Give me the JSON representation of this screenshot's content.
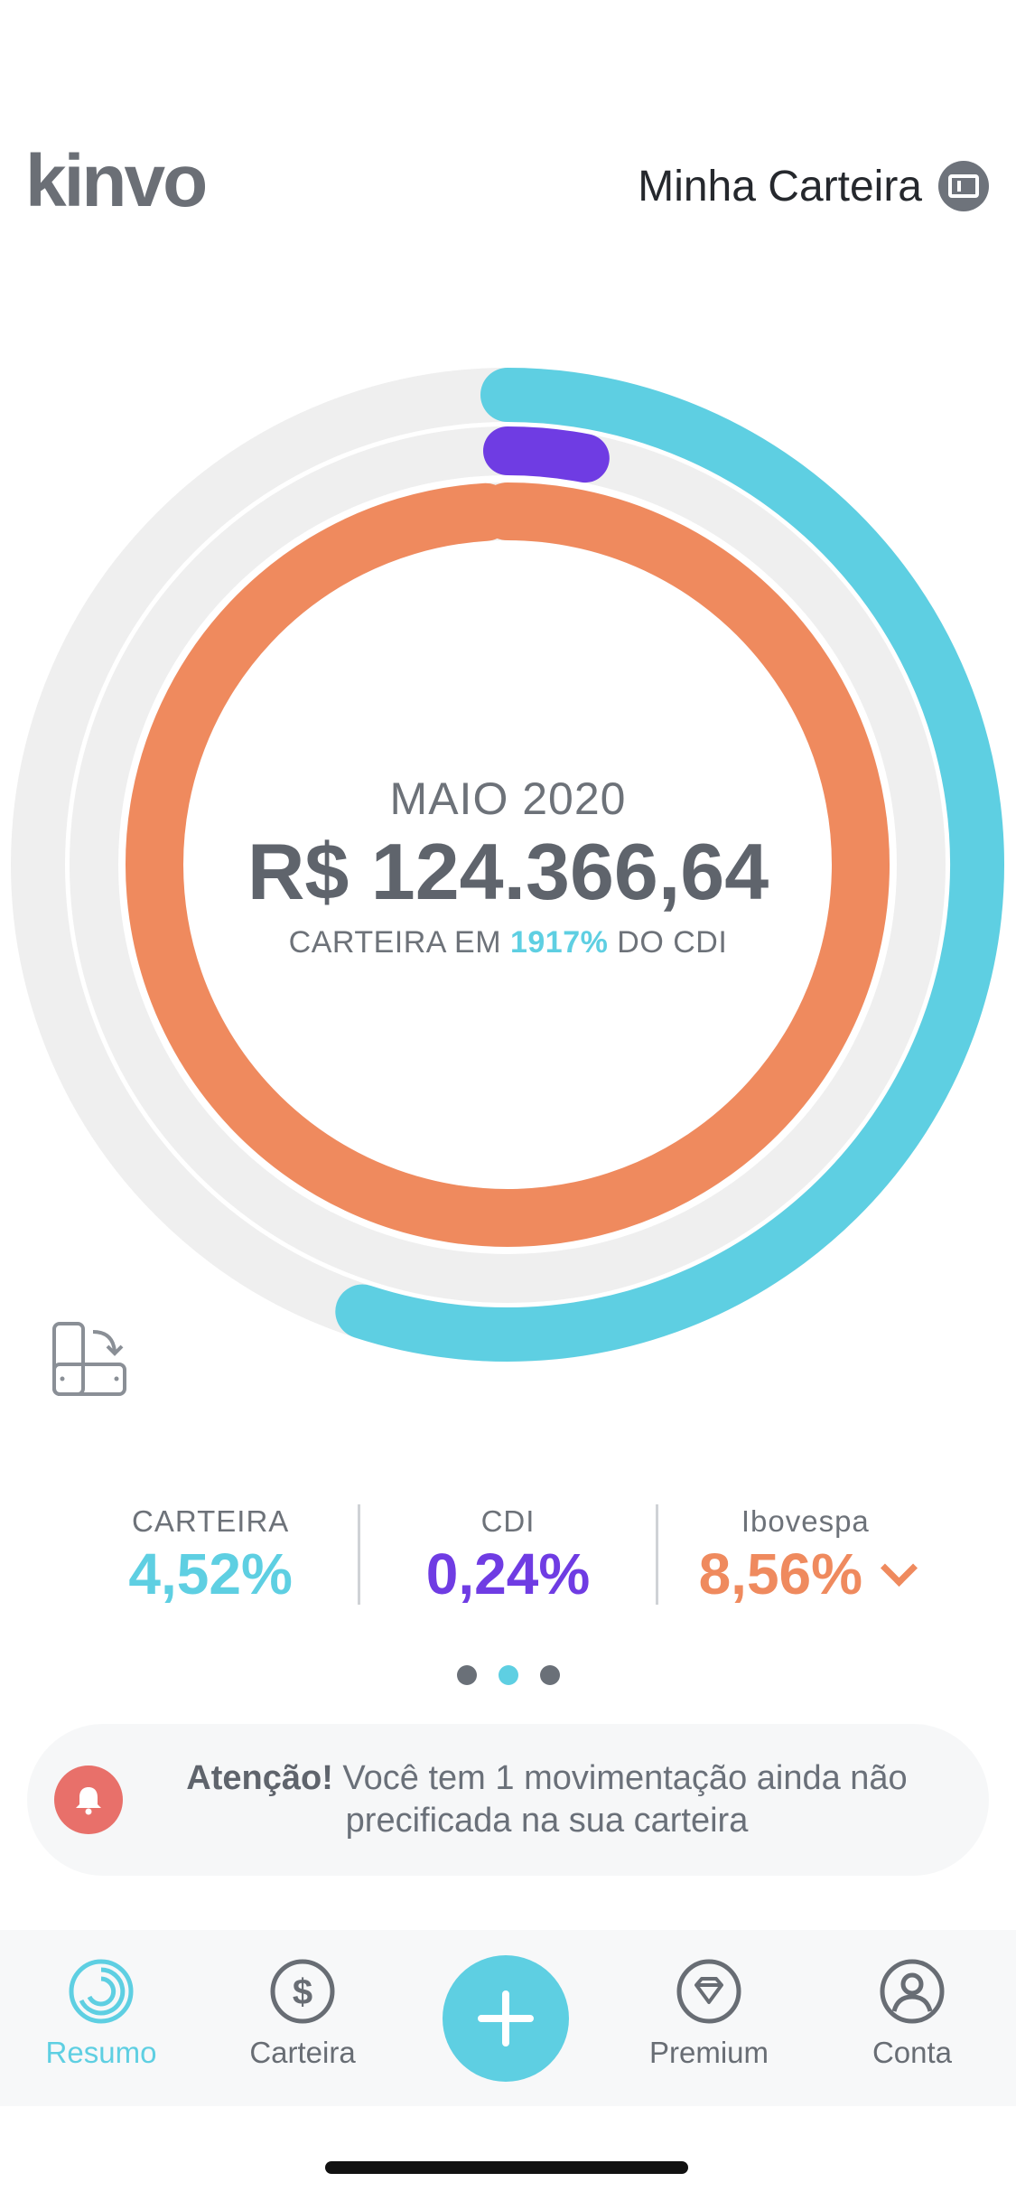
{
  "header": {
    "logo": "kinvo",
    "wallet_title": "Minha Carteira",
    "wallet_icon": "wallet-toggle-icon"
  },
  "summary": {
    "month": "MAIO 2020",
    "total": "R$ 124.366,64",
    "cdi_prefix": "CARTEIRA EM ",
    "cdi_percent": "1917%",
    "cdi_suffix": " DO CDI"
  },
  "ring_chart": {
    "rings": [
      {
        "name": "CARTEIRA",
        "color": "#5ecfe2",
        "fraction": 0.55
      },
      {
        "name": "CDI",
        "color": "#6f3ce3",
        "fraction": 0.03
      },
      {
        "name": "Ibovespa",
        "color": "#ef8a5e",
        "fraction": 0.99
      }
    ],
    "track_color": "#efefef"
  },
  "stats": [
    {
      "label": "CARTEIRA",
      "value": "4,52%",
      "color": "#5ecfe2"
    },
    {
      "label": "CDI",
      "value": "0,24%",
      "color": "#6f3ce3"
    },
    {
      "label": "Ibovespa",
      "value": "8,56%",
      "color": "#ef8a5e",
      "has_chevron": true
    }
  ],
  "pager": {
    "count": 3,
    "active": 2
  },
  "alert": {
    "strong": "Atenção!",
    "text": " Você tem 1 movimentação ainda não precificada na sua carteira",
    "icon": "bell-icon"
  },
  "tabbar": {
    "items": [
      {
        "label": "Resumo",
        "icon": "summary-icon",
        "active": true
      },
      {
        "label": "Carteira",
        "icon": "dollar-icon",
        "active": false
      },
      {
        "label": "Premium",
        "icon": "diamond-icon",
        "active": false
      },
      {
        "label": "Conta",
        "icon": "account-icon",
        "active": false
      }
    ],
    "add_button_icon": "plus-icon"
  }
}
